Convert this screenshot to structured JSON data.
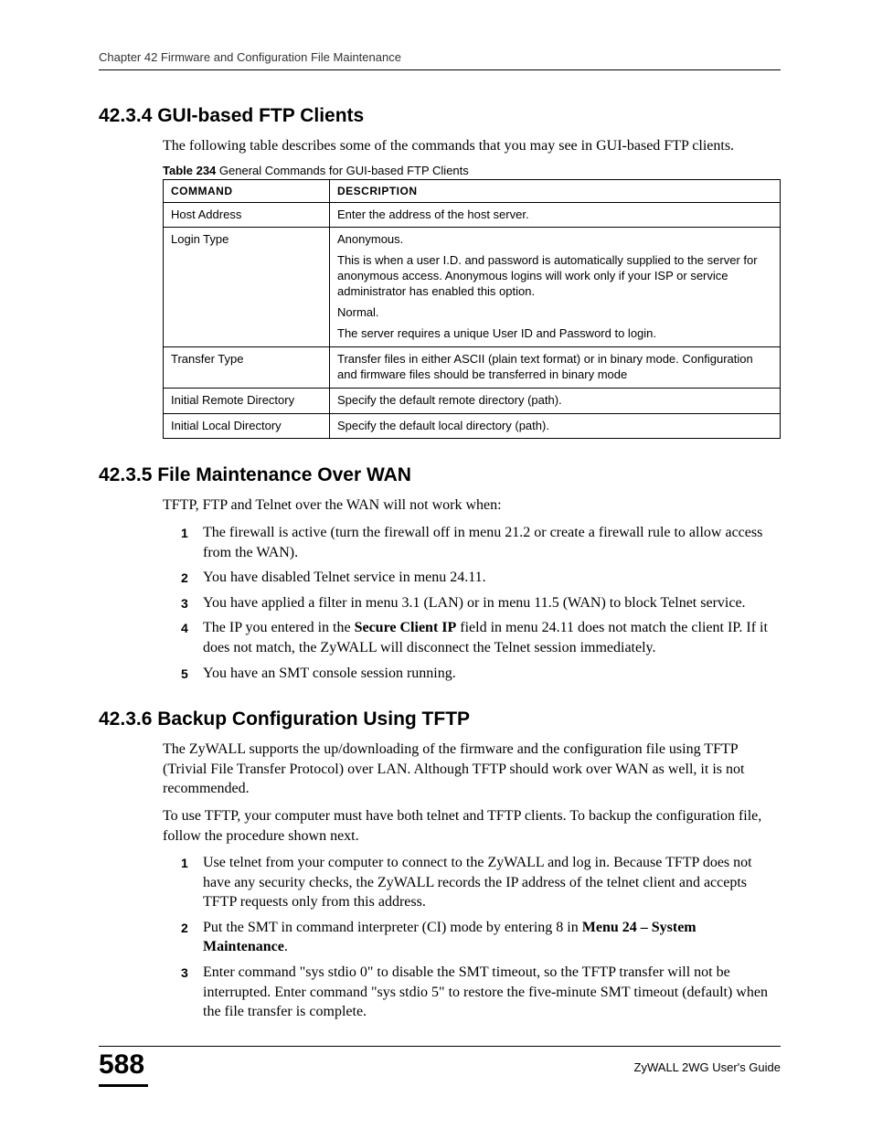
{
  "header": "Chapter 42 Firmware and Configuration File Maintenance",
  "s1": {
    "heading": "42.3.4  GUI-based FTP Clients",
    "intro": "The following table describes some of the commands that you may see in GUI-based FTP clients.",
    "tableCaptionBold": "Table 234",
    "tableCaptionRest": "   General Commands for GUI-based FTP Clients",
    "th1": "COMMAND",
    "th2": "DESCRIPTION",
    "rows": {
      "r1c1": "Host Address",
      "r1c2": "Enter the address of the host server.",
      "r2c1": "Login Type",
      "r2c2a": "Anonymous.",
      "r2c2b": "This is when a user I.D. and password is automatically supplied to the server for anonymous access. Anonymous logins will work only if your ISP or service administrator has enabled this option.",
      "r2c2c": "Normal.",
      "r2c2d": "The server requires a unique User ID and Password to login.",
      "r3c1": "Transfer Type",
      "r3c2": "Transfer files in either ASCII (plain text format) or in binary mode. Configuration and firmware files should be transferred in binary mode",
      "r4c1": "Initial Remote Directory",
      "r4c2": "Specify the default remote directory (path).",
      "r5c1": "Initial Local Directory",
      "r5c2": "Specify the default local directory (path)."
    }
  },
  "s2": {
    "heading": "42.3.5  File Maintenance Over WAN",
    "intro": "TFTP, FTP and Telnet over the WAN will not work when:",
    "items": {
      "i1": "The firewall is active (turn the firewall off in menu 21.2 or create a firewall rule to allow access from the WAN).",
      "i2": "You have disabled Telnet service in menu 24.11.",
      "i3": "You have applied a filter in menu 3.1 (LAN) or in menu 11.5 (WAN) to block Telnet service.",
      "i4a": "The IP you entered in the ",
      "i4b": "Secure Client IP",
      "i4c": " field in menu 24.11 does not match the client IP. If it does not match, the ZyWALL will disconnect the Telnet session immediately.",
      "i5": "You have an SMT console session running."
    }
  },
  "s3": {
    "heading": "42.3.6  Backup Configuration Using TFTP",
    "p1": "The ZyWALL supports the up/downloading of the firmware and the configuration file using TFTP (Trivial File Transfer Protocol) over LAN. Although TFTP should work over WAN as well, it is not recommended.",
    "p2": "To use TFTP, your computer must have both telnet and TFTP clients. To backup the configuration file, follow the procedure shown next.",
    "items": {
      "i1": "Use telnet from your computer to connect to the ZyWALL and log in. Because TFTP does not have any security checks, the ZyWALL records the IP address of the telnet client and accepts TFTP requests only from this address.",
      "i2a": "Put the SMT in command interpreter (CI) mode by entering 8 in ",
      "i2b": "Menu 24 – System Maintenance",
      "i2c": ".",
      "i3": "Enter command \"sys stdio 0\" to disable the SMT timeout, so the TFTP transfer will not be interrupted. Enter command \"sys stdio 5\" to restore the five-minute SMT timeout (default) when the file transfer is complete."
    }
  },
  "footer": {
    "page": "588",
    "guide": "ZyWALL 2WG User's Guide"
  }
}
